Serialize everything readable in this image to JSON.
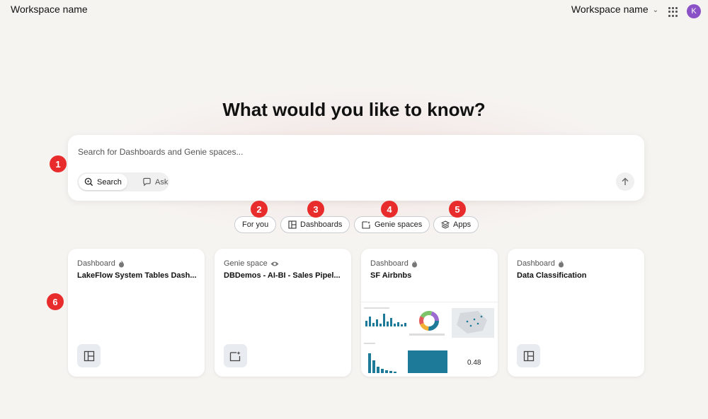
{
  "topbar": {
    "workspace_left": "Workspace name",
    "workspace_right": "Workspace name",
    "avatar_initial": "K"
  },
  "headline": "What would you like to know?",
  "search": {
    "placeholder": "Search for Dashboards and Genie spaces...",
    "mode_search": "Search",
    "mode_ask": "Ask"
  },
  "filters": [
    "For you",
    "Dashboards",
    "Genie spaces",
    "Apps"
  ],
  "badges": [
    "1",
    "2",
    "3",
    "4",
    "5",
    "6"
  ],
  "cards": [
    {
      "type": "Dashboard",
      "title": "LakeFlow System Tables Dash..."
    },
    {
      "type": "Genie space",
      "title": "DBDemos - AI-BI - Sales Pipel..."
    },
    {
      "type": "Dashboard",
      "title": "SF Airbnbs",
      "preview_value": "0.48"
    },
    {
      "type": "Dashboard",
      "title": "Data Classification"
    }
  ],
  "colors": {
    "badge": "#e82c2c",
    "avatar": "#8a52c6",
    "chart_accent": "#1e7a99"
  }
}
